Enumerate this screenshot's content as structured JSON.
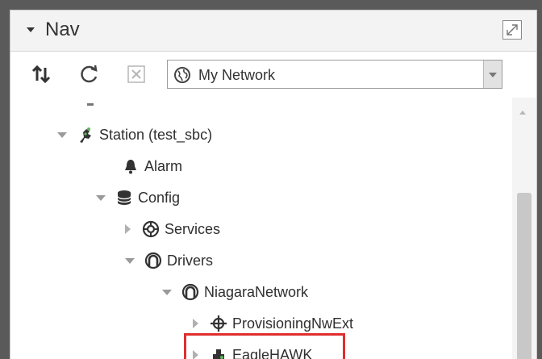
{
  "nav": {
    "title": "Nav",
    "network_select": {
      "value": "My Network"
    }
  },
  "tree": {
    "station": "Station (test_sbc)",
    "alarm": "Alarm",
    "config": "Config",
    "services": "Services",
    "drivers": "Drivers",
    "niagara_network": "NiagaraNetwork",
    "provisioning": "ProvisioningNwExt",
    "eaglehawk": "EagleHAWK"
  },
  "colors": {
    "highlight": "#e02e2e"
  }
}
